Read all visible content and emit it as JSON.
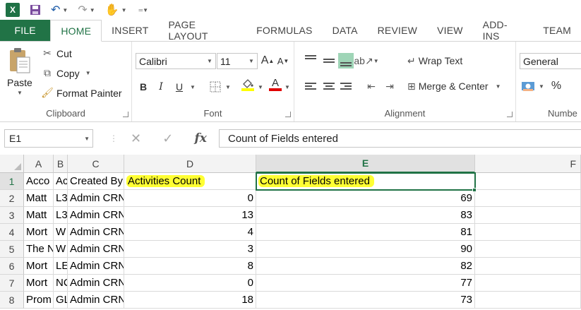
{
  "app": {
    "logo_text": "X",
    "accent": "#217346"
  },
  "tabs": [
    "FILE",
    "HOME",
    "INSERT",
    "PAGE LAYOUT",
    "FORMULAS",
    "DATA",
    "REVIEW",
    "VIEW",
    "ADD-INS",
    "TEAM"
  ],
  "ribbon": {
    "clipboard": {
      "paste": "Paste",
      "cut": "Cut",
      "copy": "Copy",
      "format_painter": "Format Painter",
      "label": "Clipboard"
    },
    "font": {
      "name": "Calibri",
      "size": "11",
      "bold": "B",
      "italic": "I",
      "underline": "U",
      "grow": "A",
      "shrink": "A",
      "font_color": "A",
      "label": "Font"
    },
    "alignment": {
      "wrap_text": "Wrap Text",
      "merge_center": "Merge & Center",
      "label": "Alignment"
    },
    "number": {
      "format": "General",
      "percent": "%",
      "label": "Numbe"
    }
  },
  "formula_bar": {
    "name_box": "E1",
    "fx": "fx",
    "value": "Count of Fields entered"
  },
  "grid": {
    "columns": [
      "A",
      "B",
      "C",
      "D",
      "E",
      "F"
    ],
    "rows": [
      {
        "num": "1",
        "a": "Acco",
        "b": "Ac",
        "c": "Created By",
        "d": "Activities Count",
        "e": "Count of Fields entered"
      },
      {
        "num": "2",
        "a": "Matt",
        "b": "L3",
        "c": "Admin CRN",
        "d": "0",
        "e": "69"
      },
      {
        "num": "3",
        "a": "Matt",
        "b": "L3",
        "c": "Admin CRN",
        "d": "13",
        "e": "83"
      },
      {
        "num": "4",
        "a": "Mort",
        "b": "W",
        "c": "Admin CRN",
        "d": "4",
        "e": "81"
      },
      {
        "num": "5",
        "a": "The N",
        "b": "W",
        "c": "Admin CRN",
        "d": "3",
        "e": "90"
      },
      {
        "num": "6",
        "a": "Mort",
        "b": "LE",
        "c": "Admin CRN",
        "d": "8",
        "e": "82"
      },
      {
        "num": "7",
        "a": "Mort",
        "b": "NC",
        "c": "Admin CRN",
        "d": "0",
        "e": "77"
      },
      {
        "num": "8",
        "a": "Prom",
        "b": "GL",
        "c": "Admin CRN",
        "d": "18",
        "e": "73"
      }
    ]
  }
}
